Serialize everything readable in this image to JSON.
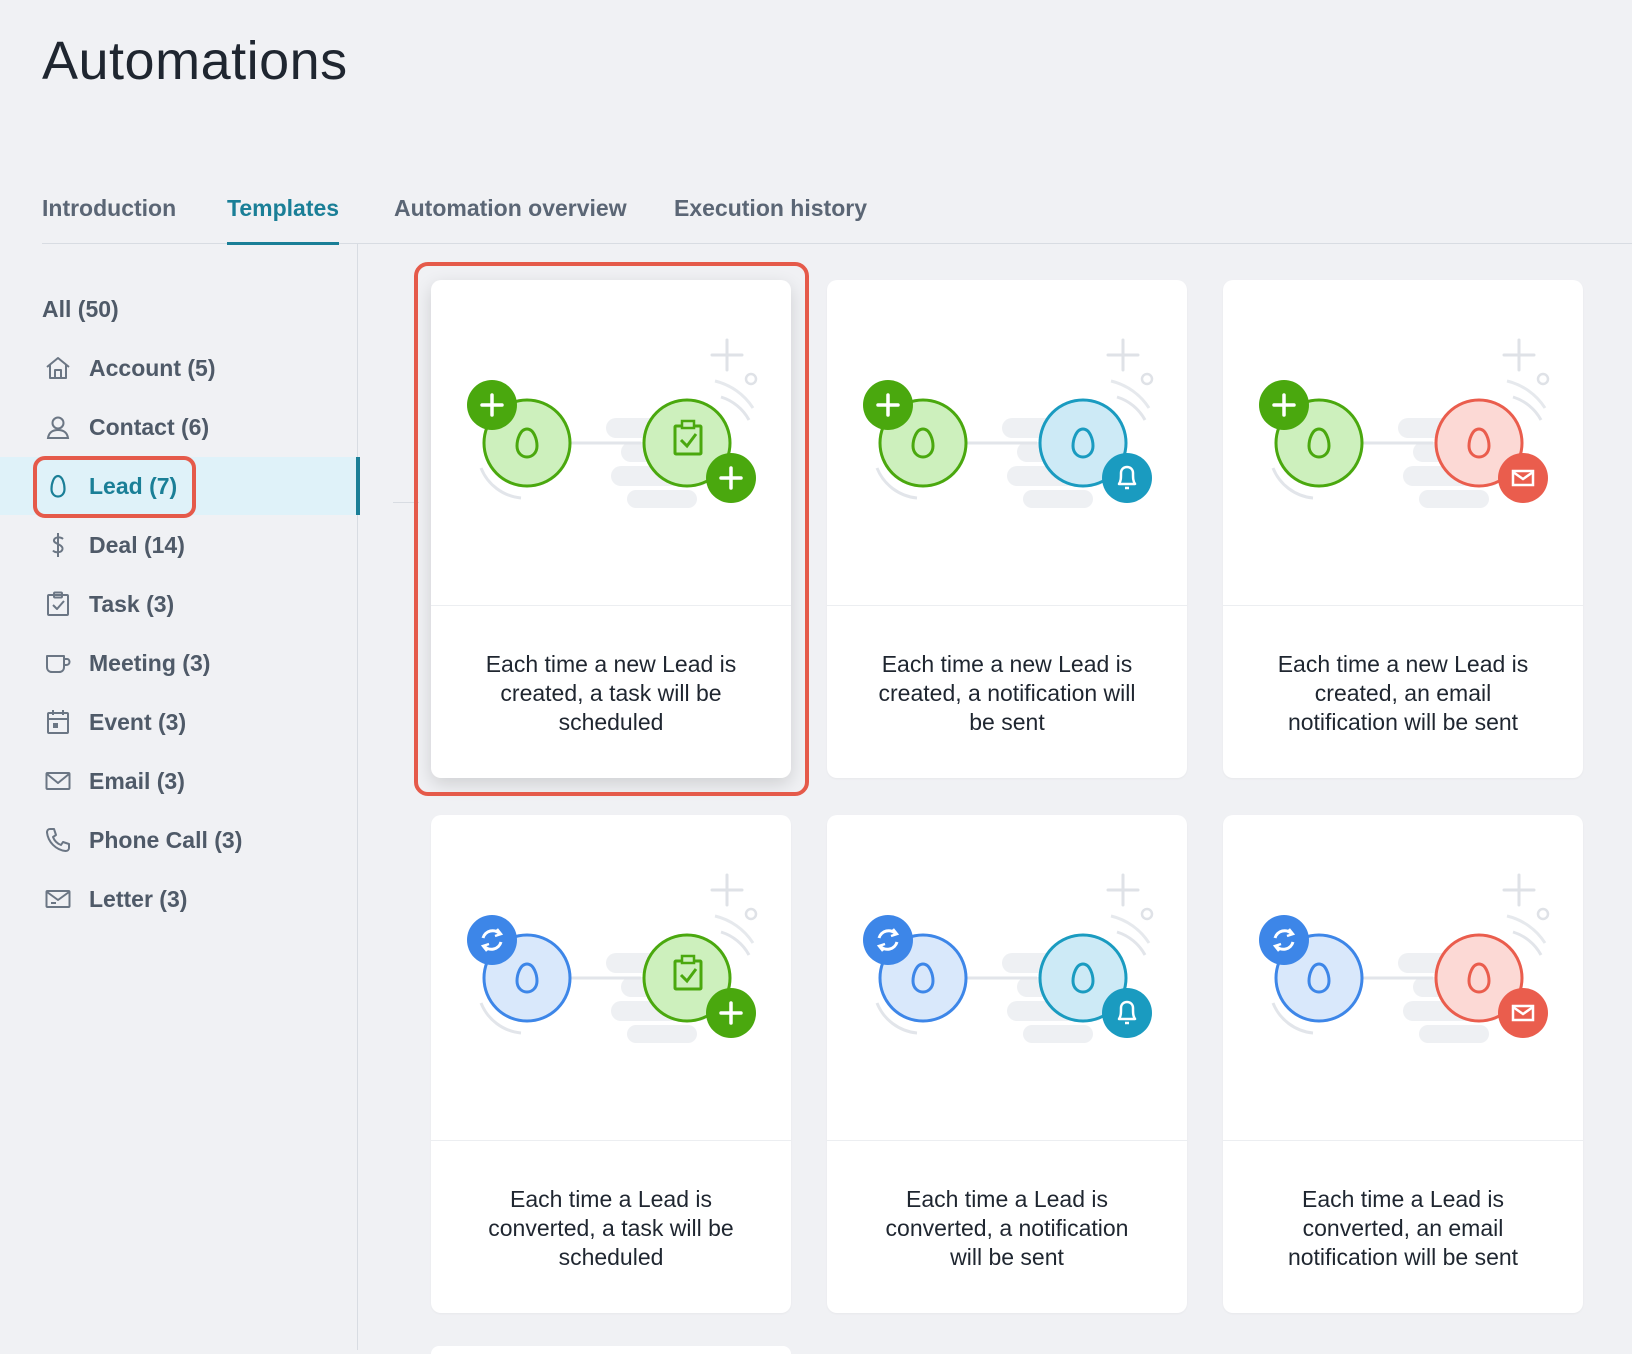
{
  "page": {
    "title": "Automations"
  },
  "tabs": [
    {
      "label": "Introduction",
      "active": false
    },
    {
      "label": "Templates",
      "active": true
    },
    {
      "label": "Automation overview",
      "active": false
    },
    {
      "label": "Execution history",
      "active": false
    }
  ],
  "sidebar": {
    "items": [
      {
        "label": "All (50)",
        "icon": ""
      },
      {
        "label": "Account (5)",
        "icon": "home-icon"
      },
      {
        "label": "Contact (6)",
        "icon": "person-icon"
      },
      {
        "label": "Lead (7)",
        "icon": "egg-icon",
        "active": true
      },
      {
        "label": "Deal (14)",
        "icon": "dollar-icon"
      },
      {
        "label": "Task (3)",
        "icon": "clipboard-check-icon"
      },
      {
        "label": "Meeting (3)",
        "icon": "mug-icon"
      },
      {
        "label": "Event (3)",
        "icon": "calendar-icon"
      },
      {
        "label": "Email (3)",
        "icon": "envelope-icon"
      },
      {
        "label": "Phone Call (3)",
        "icon": "phone-icon"
      },
      {
        "label": "Letter (3)",
        "icon": "letter-icon"
      }
    ]
  },
  "templates": [
    {
      "description": "Each time a new Lead is created, a task will be scheduled",
      "trigger": "created",
      "action": "task"
    },
    {
      "description": "Each time a new Lead is created, a notification will be sent",
      "trigger": "created",
      "action": "notification"
    },
    {
      "description": "Each time a new Lead is created, an email notification will be sent",
      "trigger": "created",
      "action": "email"
    },
    {
      "description": "Each time a Lead is converted, a task will be scheduled",
      "trigger": "converted",
      "action": "task"
    },
    {
      "description": "Each time a Lead is converted, a notification will be sent",
      "trigger": "converted",
      "action": "notification"
    },
    {
      "description": "Each time a Lead is converted, an email notification will be sent",
      "trigger": "converted",
      "action": "email"
    }
  ],
  "colors": {
    "accent": "#1a7f97",
    "highlight": "#e55a4a",
    "green": "#4aa80e",
    "green_fill": "#cdf0bd",
    "blue": "#3d86e8",
    "blue_fill": "#d9e8fb",
    "teal": "#1a9bc0",
    "teal_fill": "#cdeaf6",
    "red": "#ea5d4d",
    "red_fill": "#fcd9d5"
  }
}
